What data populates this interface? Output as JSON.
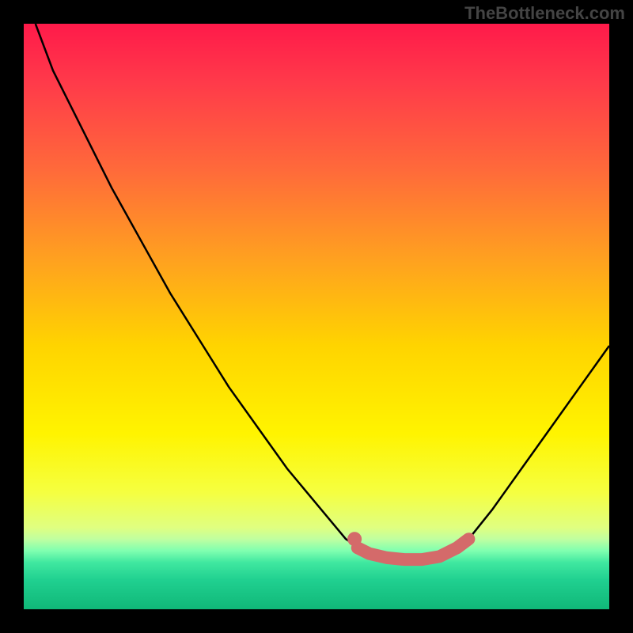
{
  "watermark": "TheBottleneck.com",
  "chart_data": {
    "type": "line",
    "title": "",
    "xlabel": "",
    "ylabel": "",
    "xlim": [
      0,
      100
    ],
    "ylim": [
      0,
      100
    ],
    "grid": false,
    "legend": false,
    "background_gradient": {
      "stops": [
        {
          "offset": 0.0,
          "color": "#ff1a4a"
        },
        {
          "offset": 0.1,
          "color": "#ff3a4a"
        },
        {
          "offset": 0.25,
          "color": "#ff6a3a"
        },
        {
          "offset": 0.4,
          "color": "#ffa020"
        },
        {
          "offset": 0.55,
          "color": "#ffd400"
        },
        {
          "offset": 0.7,
          "color": "#fff400"
        },
        {
          "offset": 0.8,
          "color": "#f5ff40"
        },
        {
          "offset": 0.86,
          "color": "#e0ff80"
        },
        {
          "offset": 0.88,
          "color": "#c0ffa0"
        },
        {
          "offset": 0.9,
          "color": "#80ffb0"
        },
        {
          "offset": 0.92,
          "color": "#40e8a0"
        },
        {
          "offset": 0.95,
          "color": "#20d090"
        },
        {
          "offset": 1.0,
          "color": "#10b878"
        }
      ]
    },
    "series": [
      {
        "name": "bottleneck-curve",
        "description": "V-shaped curve; left branch from (2,100)→min≈(60,9); right branch from (72,9)→(100,45)",
        "points": [
          {
            "x": 2,
            "y": 100
          },
          {
            "x": 5,
            "y": 92
          },
          {
            "x": 10,
            "y": 82
          },
          {
            "x": 15,
            "y": 72
          },
          {
            "x": 20,
            "y": 63
          },
          {
            "x": 25,
            "y": 54
          },
          {
            "x": 30,
            "y": 46
          },
          {
            "x": 35,
            "y": 38
          },
          {
            "x": 40,
            "y": 31
          },
          {
            "x": 45,
            "y": 24
          },
          {
            "x": 50,
            "y": 18
          },
          {
            "x": 55,
            "y": 12
          },
          {
            "x": 58,
            "y": 10
          },
          {
            "x": 60,
            "y": 9
          },
          {
            "x": 64,
            "y": 8.5
          },
          {
            "x": 68,
            "y": 8.5
          },
          {
            "x": 72,
            "y": 9
          },
          {
            "x": 76,
            "y": 12
          },
          {
            "x": 80,
            "y": 17
          },
          {
            "x": 85,
            "y": 24
          },
          {
            "x": 90,
            "y": 31
          },
          {
            "x": 95,
            "y": 38
          },
          {
            "x": 100,
            "y": 45
          }
        ]
      },
      {
        "name": "highlight-segment",
        "description": "salmon thick overlay marking the trough",
        "color": "#d46a6a",
        "points": [
          {
            "x": 57,
            "y": 10.5
          },
          {
            "x": 59,
            "y": 9.5
          },
          {
            "x": 62,
            "y": 8.8
          },
          {
            "x": 65,
            "y": 8.5
          },
          {
            "x": 68,
            "y": 8.5
          },
          {
            "x": 71,
            "y": 9.0
          },
          {
            "x": 74,
            "y": 10.5
          },
          {
            "x": 76,
            "y": 12.0
          }
        ]
      }
    ]
  }
}
